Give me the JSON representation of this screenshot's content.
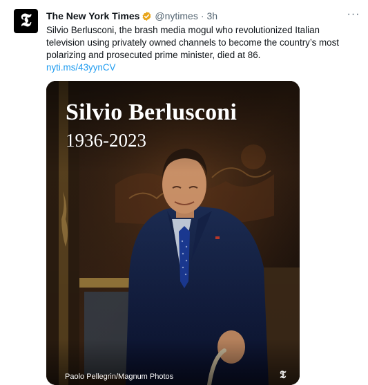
{
  "account": {
    "avatar_glyph": "𝕿",
    "name": "The New York Times",
    "handle": "@nytimes",
    "separator": "·",
    "time": "3h",
    "verified_icon": "gold-verified-badge",
    "verified_color": "#e8a51b"
  },
  "tweet": {
    "text": "Silvio Berlusconi, the brash media mogul who revolutionized Italian television using privately owned channels to become the country’s most polarizing and prosecuted prime minister, died at 86.",
    "link": "nyti.ms/43yynCV",
    "more_icon": "···"
  },
  "media": {
    "title": "Silvio Berlusconi",
    "years": "1936-2023",
    "credit": "Paolo Pellegrin/Magnum Photos",
    "mark": "𝕿"
  },
  "colors": {
    "link": "#1d9bf0",
    "secondary_text": "#536471",
    "text": "#0f1419"
  }
}
